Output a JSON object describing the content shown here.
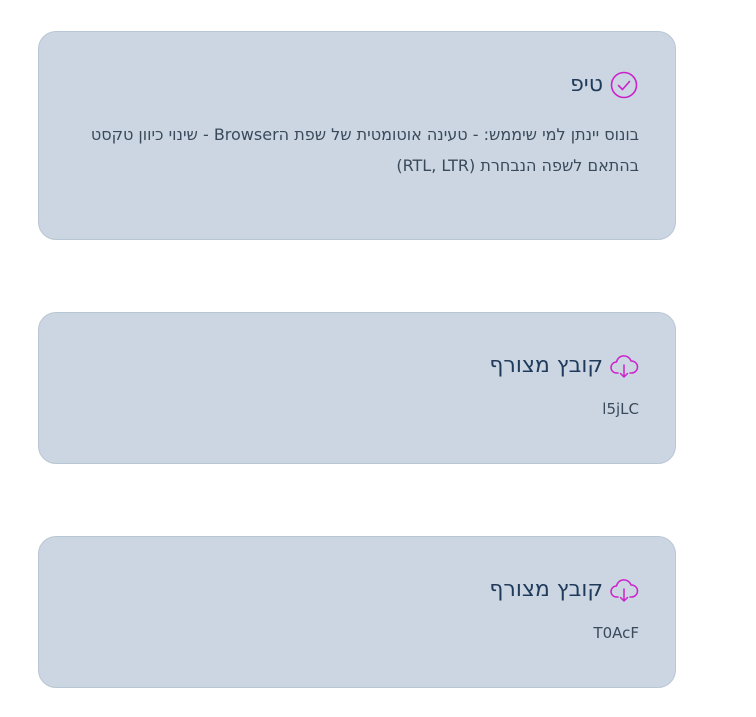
{
  "tip": {
    "title": "טיפ",
    "icon": "check-circle-icon",
    "text": "בונוס יינתן למי שיממש: - טעינה אוטומטית של שפת הBrowser - שינוי כיוון טקסט בהתאם לשפה הנבחרת (RTL, LTR)"
  },
  "attachments": [
    {
      "title": "קובץ מצורף",
      "icon": "cloud-download-icon",
      "file": "l5jLC"
    },
    {
      "title": "קובץ מצורף",
      "icon": "cloud-download-icon",
      "file": "T0AcF"
    }
  ],
  "colors": {
    "card_bg": "#cbd6e2",
    "icon": "#cc22cc",
    "title": "#1f3a5a",
    "text": "#3a4a5a"
  }
}
